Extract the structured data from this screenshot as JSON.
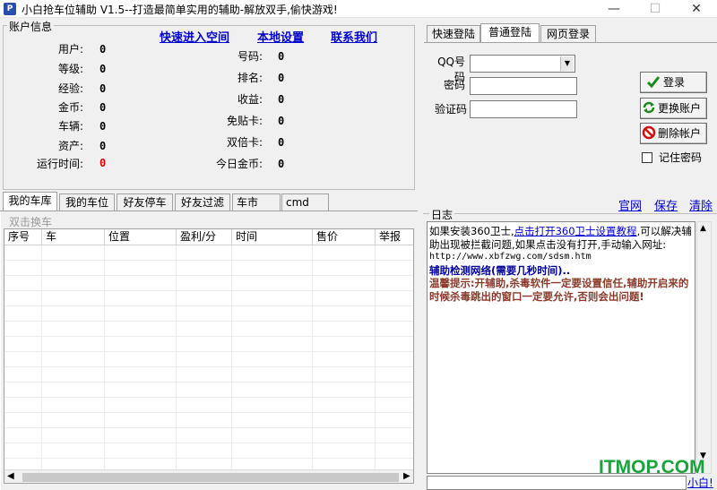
{
  "window": {
    "title": "小白抢车位辅助 V1.5--打造最简单实用的辅助-解放双手,偷快游戏!",
    "icon_text": "P",
    "controls": {
      "minimize": "—",
      "maximize": "☐",
      "close": "✕"
    }
  },
  "account": {
    "legend": "账户信息",
    "links": [
      "快速进入空间",
      "本地设置",
      "联系我们"
    ],
    "left_fields": [
      {
        "label": "用户:",
        "value": "0"
      },
      {
        "label": "等级:",
        "value": "0"
      },
      {
        "label": "经验:",
        "value": "0"
      },
      {
        "label": "金币:",
        "value": "0"
      },
      {
        "label": "车辆:",
        "value": "0"
      },
      {
        "label": "资产:",
        "value": "0"
      },
      {
        "label": "运行时间:",
        "value": "0"
      }
    ],
    "right_fields": [
      {
        "label": "号码:",
        "value": "0"
      },
      {
        "label": "排名:",
        "value": "0"
      },
      {
        "label": "收益:",
        "value": "0"
      },
      {
        "label": "免贴卡:",
        "value": "0"
      },
      {
        "label": "双倍卡:",
        "value": "0"
      },
      {
        "label": "今日金币:",
        "value": "0"
      }
    ]
  },
  "login": {
    "tabs": [
      "快速登陆",
      "普通登陆",
      "网页登录"
    ],
    "active_tab": "普通登陆",
    "qq_label": "QQ号码",
    "qq_value": "",
    "password_label": "密码",
    "captcha_label": "验证码",
    "login_button": "登录",
    "switch_button": "更换账户",
    "delete_button": "删除帐户",
    "remember_label": "记住密码"
  },
  "bottom_tabs": [
    "我的车库",
    "我的车位",
    "好友停车",
    "好友过滤",
    "车市",
    "cmd"
  ],
  "active_bottom_tab": "我的车库",
  "garage": {
    "hint": "双击换车",
    "columns": [
      "序号",
      "车",
      "位置",
      "盈利/分",
      "时间",
      "售价",
      "举报"
    ]
  },
  "log": {
    "links": [
      "官网",
      "保存",
      "清除"
    ],
    "legend": "日志",
    "lines": {
      "l1_pre": "如果安装360卫士,",
      "l1_link": "点击打开360卫士设置教程",
      "l1_post": ",可以解决辅助出现被拦截问题,如果点击没有打开,手动输入网址:",
      "l2": "http://www.xbfzwg.com/sdsm.htm",
      "l3": "辅助检测网络(需要几秒时间)..",
      "l4": "温馨提示:开辅助,杀毒软件一定要设置信任,辅助开启来的时候杀毒跳出的窗口一定要允许,否则会出问题!"
    },
    "status_link": "小白!"
  },
  "watermark": "ITMOP.COM",
  "colors": {
    "link": "#0000cc",
    "red": "#e00000",
    "log_blue": "#000099",
    "log_brown": "#8b3a2a"
  }
}
